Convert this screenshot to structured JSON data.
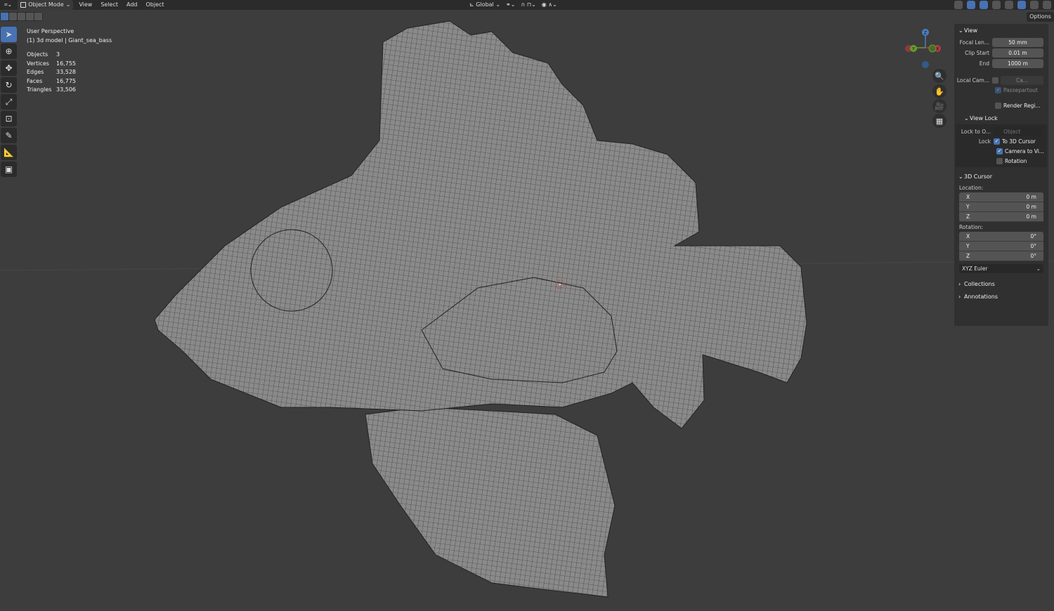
{
  "header": {
    "mode": "Object Mode",
    "menus": [
      "View",
      "Select",
      "Add",
      "Object"
    ],
    "orientation": "Global"
  },
  "viewport": {
    "title": "User Perspective",
    "subtitle": "(1) 3d model | Giant_sea_bass",
    "stats": [
      {
        "label": "Objects",
        "value": "3"
      },
      {
        "label": "Vertices",
        "value": "16,755"
      },
      {
        "label": "Edges",
        "value": "33,528"
      },
      {
        "label": "Faces",
        "value": "16,775"
      },
      {
        "label": "Triangles",
        "value": "33,506"
      }
    ]
  },
  "gizmo": {
    "z": "Z",
    "y": "Y",
    "x": "X"
  },
  "options_label": "Options",
  "panel": {
    "view": {
      "title": "View",
      "focal_label": "Focal Len...",
      "focal": "50 mm",
      "clip_start_label": "Clip Start",
      "clip_start": "0.01 m",
      "end_label": "End",
      "end": "1000 m",
      "local_cam_label": "Local Cam...",
      "local_cam_value": "Ca...",
      "passepartout": "Passepartout",
      "render_region": "Render Regi..."
    },
    "view_lock": {
      "title": "View Lock",
      "lock_to_label": "Lock to O...",
      "lock_to_placeholder": "Object",
      "lock_label": "Lock",
      "to_cursor": "To 3D Cursor",
      "camera_to_view": "Camera to Vi...",
      "rotation": "Rotation"
    },
    "cursor": {
      "title": "3D Cursor",
      "location_label": "Location:",
      "location": [
        {
          "axis": "X",
          "value": "0 m"
        },
        {
          "axis": "Y",
          "value": "0 m"
        },
        {
          "axis": "Z",
          "value": "0 m"
        }
      ],
      "rotation_label": "Rotation:",
      "rotation": [
        {
          "axis": "X",
          "value": "0°"
        },
        {
          "axis": "Y",
          "value": "0°"
        },
        {
          "axis": "Z",
          "value": "0°"
        }
      ],
      "rotation_mode": "XYZ Euler"
    },
    "collections": "Collections",
    "annotations": "Annotations"
  }
}
